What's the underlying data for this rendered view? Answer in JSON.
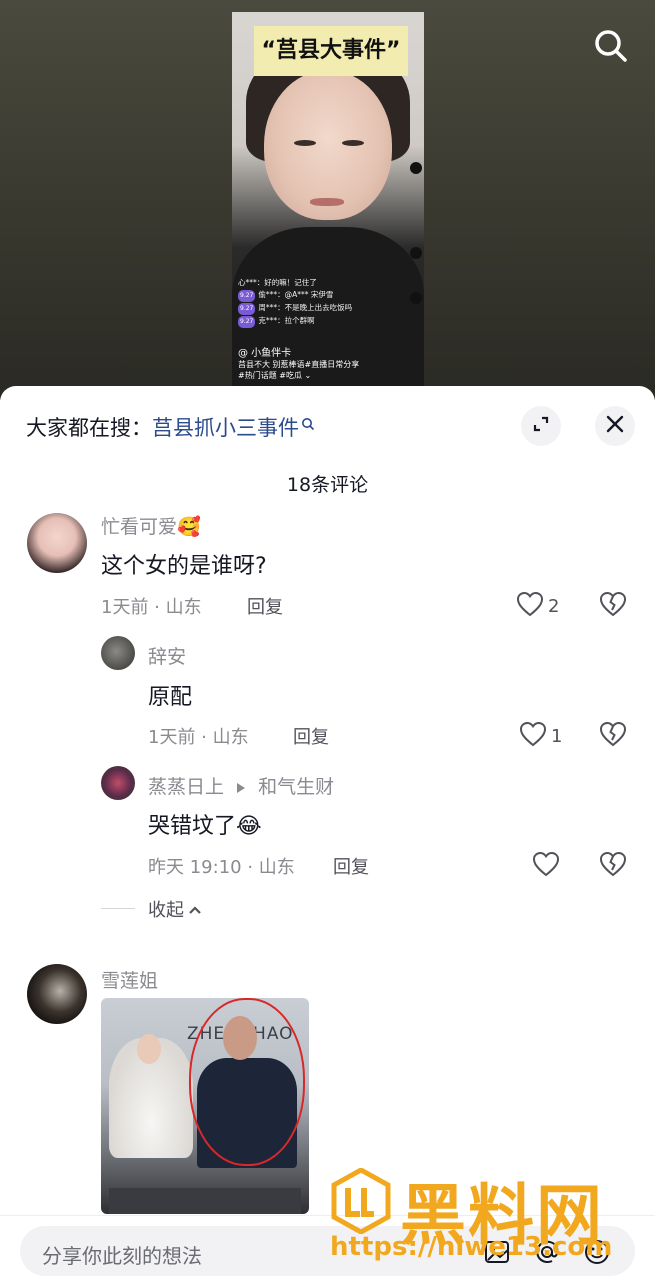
{
  "video": {
    "thumb_title": "“莒县大事件”",
    "chat_lines": [
      {
        "user": "心***",
        "text": "好的嘛！记住了"
      },
      {
        "badge": "9.27",
        "user": "偷***",
        "text": "@A***  宋伊雪"
      },
      {
        "badge": "9.27",
        "user": "周***",
        "text": "不是晚上出去吃饭吗"
      },
      {
        "badge": "9.27",
        "user": "克***",
        "text": "拉个群啊"
      }
    ],
    "mention": "@  小鱼伴卡",
    "tags_line1": "莒县不大 别惹棒语#直播日常分享",
    "tags_line2": "#热门话题 #吃瓜 ⌄"
  },
  "sheet": {
    "hot_search_prefix": "大家都在搜：",
    "hot_search_keyword": "莒县抓小三事件",
    "comment_count": "18条评论"
  },
  "comments": [
    {
      "user": "忙看可爱🥰",
      "text": "这个女的是谁呀?",
      "meta": "1天前 · 山东",
      "reply_label": "回复",
      "likes": "2"
    },
    {
      "user": "辞安",
      "text": "原配",
      "meta": "1天前 · 山东",
      "reply_label": "回复",
      "likes": "1"
    },
    {
      "user": "蒸蒸日上",
      "reply_to": "和气生财",
      "text": "哭错坟了😂",
      "meta": "昨天 19:10 · 山东",
      "reply_label": "回复",
      "likes": ""
    },
    {
      "user": "雪莲姐"
    }
  ],
  "collapse_label": "收起",
  "photo_text": "ZHENGHAO",
  "input_placeholder": "分享你此刻的想法",
  "watermark": {
    "title": "黑料网",
    "url": "https://hlwe13.com"
  },
  "colors": {
    "keyword_blue": "#2c4b8c",
    "muted": "#8a8b91",
    "watermark": "#f2a81e"
  }
}
